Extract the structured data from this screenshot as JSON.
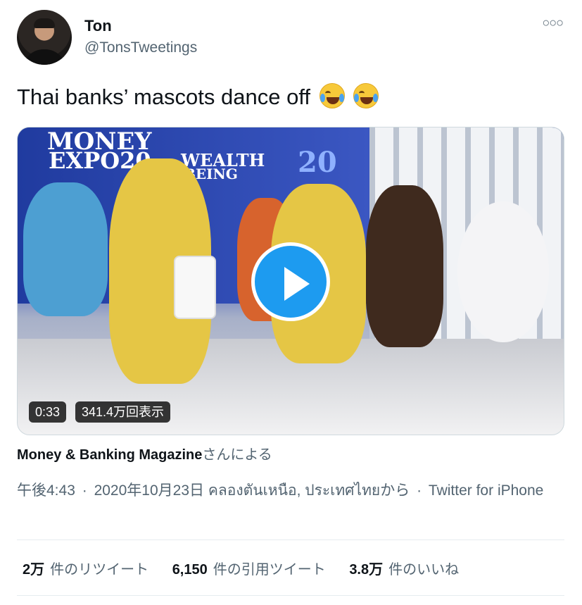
{
  "user": {
    "name": "Ton",
    "handle": "@TonsTweetings"
  },
  "tweet": {
    "text": "Thai banks’ mascots dance off",
    "emojis": [
      "face-with-tears-of-joy",
      "face-with-tears-of-joy"
    ]
  },
  "video": {
    "duration": "0:33",
    "views": "341.4万回表示",
    "screen_text_1": "MONEY",
    "screen_text_2": "EXPO20",
    "screen_text_3": "WEALTH",
    "screen_text_4": "BEING",
    "screen_text_5": "20"
  },
  "source": {
    "name": "Money & Banking Magazine",
    "suffix": "さんによる"
  },
  "meta": {
    "time": "午後4:43",
    "separator": "·",
    "date": "2020年10月23日",
    "location": "คลองตันเหนือ, ประเทศไทยから",
    "client": "Twitter for iPhone"
  },
  "stats": {
    "retweets_value": "2万",
    "retweets_label": "件のリツイート",
    "quotes_value": "6,150",
    "quotes_label": "件の引用ツイート",
    "likes_value": "3.8万",
    "likes_label": "件のいいね"
  },
  "colors": {
    "accent": "#1d9bf0",
    "text_primary": "#0f1419",
    "text_secondary": "#536471"
  }
}
